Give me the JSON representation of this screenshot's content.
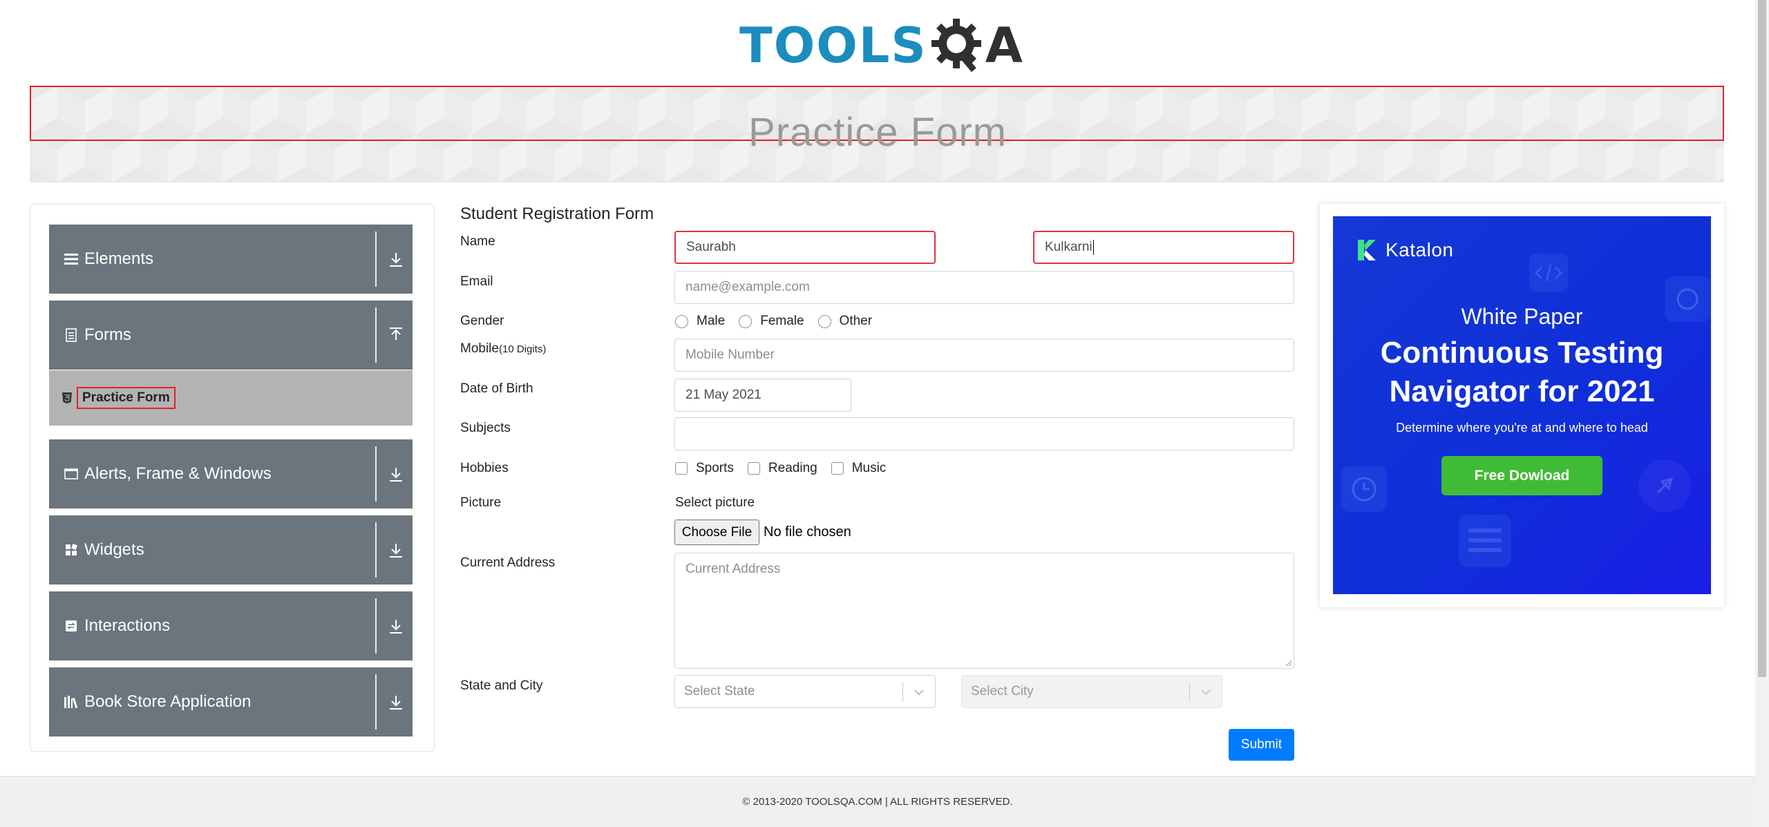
{
  "header": {
    "logo_text_left": "TOOLS",
    "logo_text_right": "A"
  },
  "banner": {
    "title": "Practice Form"
  },
  "sidebar": {
    "groups": [
      {
        "label": "Elements",
        "icon": "hamburger-icon",
        "arrow": "download-arrow-icon"
      },
      {
        "label": "Forms",
        "icon": "document-icon",
        "arrow": "upload-arrow-icon"
      },
      {
        "label": "Alerts, Frame & Windows",
        "icon": "window-icon",
        "arrow": "download-arrow-icon"
      },
      {
        "label": "Widgets",
        "icon": "grid-icon",
        "arrow": "download-arrow-icon"
      },
      {
        "label": "Interactions",
        "icon": "swap-icon",
        "arrow": "download-arrow-icon"
      },
      {
        "label": "Book Store Application",
        "icon": "books-icon",
        "arrow": "download-arrow-icon"
      }
    ],
    "active_item": {
      "label": "Practice Form",
      "icon": "html5-icon"
    }
  },
  "form": {
    "title": "Student Registration Form",
    "labels": {
      "name": "Name",
      "email": "Email",
      "gender": "Gender",
      "mobile": "Mobile",
      "mobile_hint": "(10 Digits)",
      "dob": "Date of Birth",
      "subjects": "Subjects",
      "hobbies": "Hobbies",
      "picture": "Picture",
      "address": "Current Address",
      "state_city": "State and City"
    },
    "first_name": {
      "value": "Saurabh"
    },
    "last_name": {
      "value": "Kulkarni"
    },
    "email": {
      "placeholder": "name@example.com"
    },
    "gender_options": [
      "Male",
      "Female",
      "Other"
    ],
    "mobile": {
      "placeholder": "Mobile Number"
    },
    "dob": {
      "value": "21 May 2021"
    },
    "subjects": {
      "value": ""
    },
    "hobby_options": [
      "Sports",
      "Reading",
      "Music"
    ],
    "picture": {
      "prompt": "Select picture",
      "button": "Choose File",
      "status": "No file chosen"
    },
    "address": {
      "placeholder": "Current Address"
    },
    "state": {
      "placeholder": "Select State"
    },
    "city": {
      "placeholder": "Select City"
    },
    "submit_label": "Submit"
  },
  "ad": {
    "brand": "Katalon",
    "kicker": "White Paper",
    "headline_line1": "Continuous Testing",
    "headline_line2": "Navigator for 2021",
    "subtext": "Determine where you're at and where to head",
    "cta": "Free Dowload",
    "colors": {
      "background": "#1538d6",
      "cta": "#3fbc36"
    }
  },
  "footer": {
    "text": "© 2013-2020 TOOLSQA.COM | ALL RIGHTS RESERVED."
  },
  "colors": {
    "sidebar_group": "#6c757d",
    "active_item": "#b3b3b3",
    "highlight_border": "#e0202a",
    "invalid_border": "#dc3545",
    "primary": "#007bff"
  }
}
